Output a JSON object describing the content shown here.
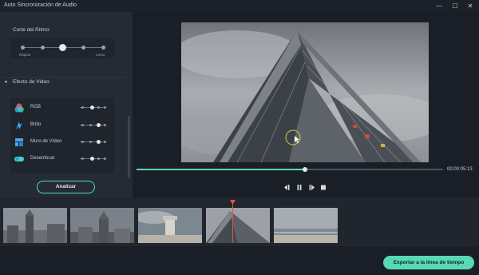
{
  "window": {
    "title": "Auto Sincronización de Audio",
    "minimize_glyph": "—",
    "maximize_glyph": "☐",
    "close_glyph": "✕"
  },
  "beat": {
    "label": "Corte del Ritmo:",
    "min_label": "Rápido",
    "max_label": "Lento",
    "positions": 5,
    "selected_index": 2
  },
  "effects": {
    "label": "Efecto de Video",
    "items": [
      {
        "label": "RGB",
        "icon": "rgb-icon",
        "level_index": 2,
        "color": "#e8567c"
      },
      {
        "label": "Brillo",
        "icon": "brightness-icon",
        "level_index": 3,
        "color": "#3fa6f2"
      },
      {
        "label": "Muro de Vídeo",
        "icon": "video-wall-icon",
        "level_index": 3,
        "color": "#3fa6f2"
      },
      {
        "label": "Desenfocar",
        "icon": "blur-icon",
        "level_index": 2,
        "color": "#3fd3c4"
      }
    ]
  },
  "analyze_button": "Analizar",
  "player": {
    "timecode": "00:00:05:13",
    "progress": 0.55
  },
  "controls": {
    "prev": "prev-frame-icon",
    "pause": "pause-icon",
    "next": "next-frame-icon",
    "stop": "stop-icon"
  },
  "timeline": {
    "clips": [
      "clip-1",
      "clip-2",
      "clip-3",
      "clip-4",
      "clip-5"
    ]
  },
  "export_button": "Exportar a la línea de tiempo",
  "colors": {
    "accent": "#58d9b6",
    "playhead": "#e2524a",
    "panel": "#252b35",
    "background": "#1a1f27"
  }
}
